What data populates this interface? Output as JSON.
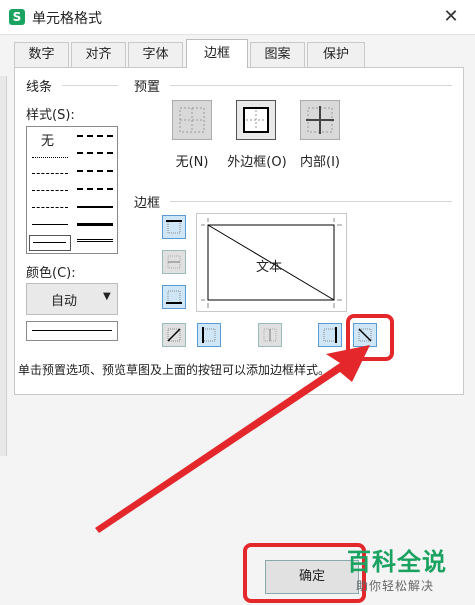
{
  "window": {
    "title": "单元格格式",
    "app_icon_letter": "S"
  },
  "tabs": [
    {
      "label": "数字",
      "active": false
    },
    {
      "label": "对齐",
      "active": false
    },
    {
      "label": "字体",
      "active": false
    },
    {
      "label": "边框",
      "active": true
    },
    {
      "label": "图案",
      "active": false
    },
    {
      "label": "保护",
      "active": false
    }
  ],
  "line_group": {
    "title": "线条",
    "style_label": "样式(S):",
    "none_label": "无",
    "color_label": "颜色(C):",
    "color_value": "自动"
  },
  "presets": {
    "title": "预置",
    "items": [
      {
        "label": "无(N)"
      },
      {
        "label": "外边框(O)"
      },
      {
        "label": "内部(I)"
      }
    ]
  },
  "border_group": {
    "title": "边框",
    "preview_text": "文本"
  },
  "hint": "单击预置选项、预览草图及上面的按钮可以添加边框样式。",
  "ok_button": "确定",
  "watermark": {
    "title": "百科全说",
    "subtitle": "助你轻松解决"
  },
  "colors": {
    "highlight": "#e3272b",
    "toggle_on": "#cfe6f7",
    "brand_green": "#1aa260"
  }
}
